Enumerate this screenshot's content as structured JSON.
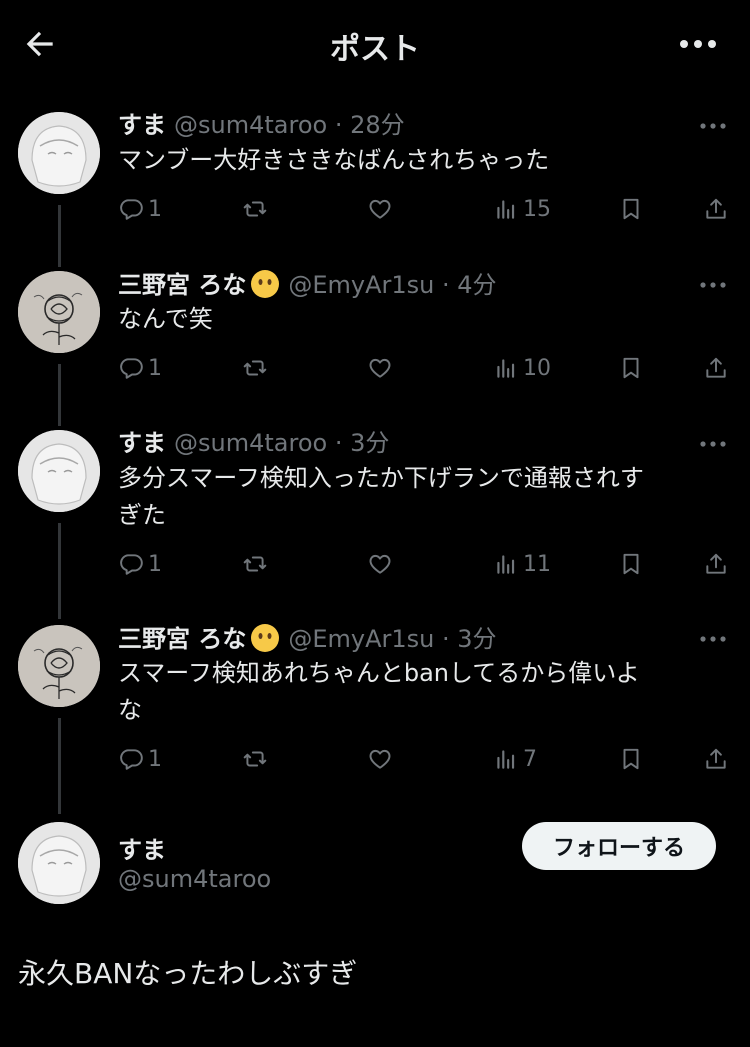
{
  "header": {
    "title": "ポスト",
    "back_icon": "arrow-left-icon",
    "more_icon": "more-horizontal-icon"
  },
  "tweets": [
    {
      "name": "すま",
      "handle": "@sum4taroo",
      "time": "28分",
      "has_emoji": false,
      "lines": [
        "マンブー大好きさきなばんされちゃった"
      ],
      "replies": "1",
      "retweets": "",
      "likes": "",
      "views": "15"
    },
    {
      "name": "三野宮 ろな",
      "handle": "@EmyAr1su",
      "time": "4分",
      "has_emoji": true,
      "lines": [
        "なんで笑"
      ],
      "replies": "1",
      "retweets": "",
      "likes": "",
      "views": "10"
    },
    {
      "name": "すま",
      "handle": "@sum4taroo",
      "time": "3分",
      "has_emoji": false,
      "lines": [
        "多分スマーフ検知入ったか下げランで通報されす",
        "ぎた"
      ],
      "replies": "1",
      "retweets": "",
      "likes": "",
      "views": "11"
    },
    {
      "name": "三野宮 ろな",
      "handle": "@EmyAr1su",
      "time": "3分",
      "has_emoji": true,
      "lines": [
        "スマーフ検知あれちゃんとbanしてるから偉いよ",
        "な"
      ],
      "replies": "1",
      "retweets": "",
      "likes": "",
      "views": "7"
    }
  ],
  "main_post": {
    "name": "すま",
    "handle": "@sum4taroo",
    "follow_label": "フォローする",
    "text": "永久BANなったわしぶすぎ"
  },
  "colors": {
    "background": "#000000",
    "primary_text": "#e7e9ea",
    "secondary_text": "#71767b",
    "follow_bg": "#eff3f4"
  }
}
